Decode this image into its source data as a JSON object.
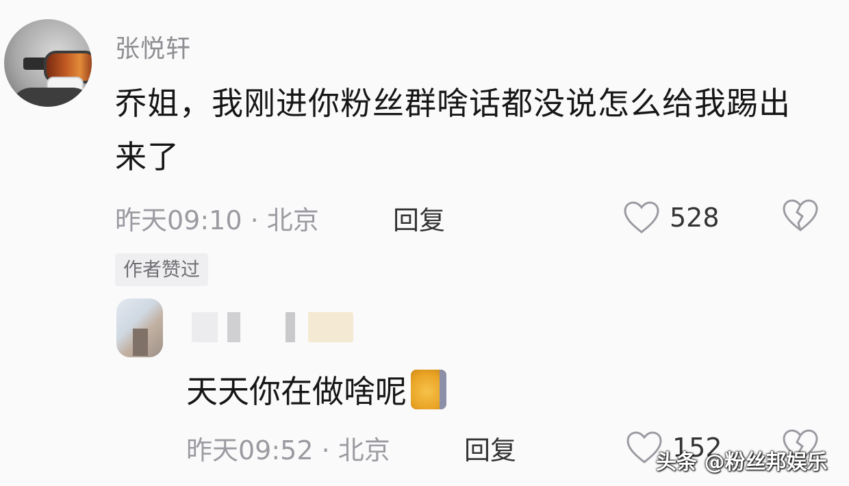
{
  "comment": {
    "username": "张悦轩",
    "text": "乔姐，我刚进你粉丝群啥话都没说怎么给我踢出来了",
    "time_location": "昨天09:10 · 北京",
    "reply_label": "回复",
    "likes": "528",
    "author_tag": "作者赞过"
  },
  "reply": {
    "text": "天天你在做啥呢",
    "time_location": "昨天09:52 · 北京",
    "reply_label": "回复",
    "likes": "152"
  },
  "watermark": "头条 @粉丝邦娱乐"
}
